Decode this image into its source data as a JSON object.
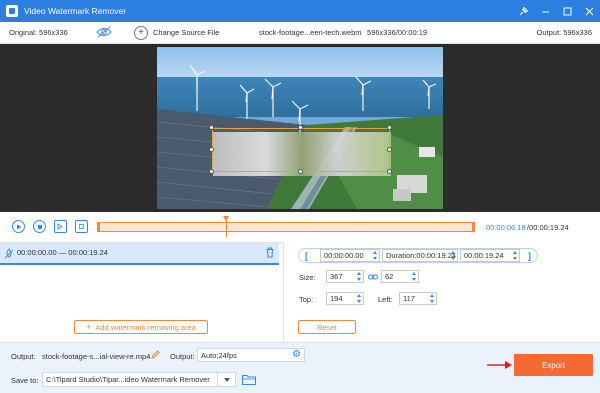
{
  "titlebar": {
    "title": "Video Watermark Remover",
    "icons": [
      "app-icon",
      "pin-icon",
      "minimize-icon",
      "maximize-icon",
      "close-icon"
    ]
  },
  "info": {
    "original": "Original: 596x336",
    "change_source": "Change Source File",
    "filename": "stock-footage...een-tech.webm",
    "dimensions_duration": "596x336/00:00:19",
    "output": "Output: 596x336"
  },
  "timeline": {
    "current_time": "00:00:06.18",
    "total_time": "/00:00:19.24",
    "playhead_fraction": 0.34
  },
  "segment": {
    "range": "00:00:00.00 — 00:00:19.24"
  },
  "area": {
    "add_label": "Add watermark removing area"
  },
  "range": {
    "start": "00:00:00.00",
    "duration": "Duration:00:00:19.24",
    "end": "00:00:19.24"
  },
  "size": {
    "label": "Size:",
    "width": "367",
    "height": "62"
  },
  "position": {
    "top_label": "Top:",
    "top": "194",
    "left_label": "Left:",
    "left": "117"
  },
  "reset_label": "Reset",
  "bottom": {
    "output_label": "Output:",
    "output_file": "stock-footage-s...ial-view-re.mp4",
    "output_format_label": "Output:",
    "output_format": "Auto;24fps",
    "save_label": "Save to:",
    "save_path": "C:\\Tipard Studio\\Tipar...ideo Watermark Remover"
  },
  "export_label": "Export",
  "colors": {
    "accent": "#2a7fe0",
    "orange": "#f08a3a",
    "export": "#f36b32"
  }
}
